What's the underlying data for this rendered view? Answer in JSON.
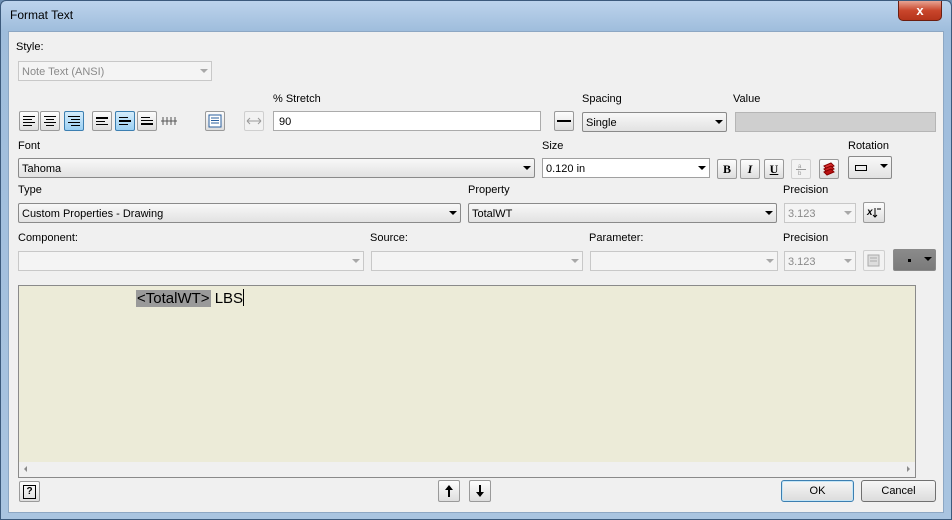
{
  "window": {
    "title": "Format Text",
    "close_glyph": "x"
  },
  "style": {
    "label": "Style:",
    "value": "Note Text (ANSI)"
  },
  "stretch": {
    "label": "% Stretch",
    "value": "90"
  },
  "spacing": {
    "label": "Spacing",
    "value": "Single"
  },
  "value_field": {
    "label": "Value",
    "value": ""
  },
  "font": {
    "label": "Font",
    "value": "Tahoma"
  },
  "size": {
    "label": "Size",
    "value": "0.120 in"
  },
  "format_buttons": {
    "bold": "B",
    "italic": "I",
    "underline": "U"
  },
  "rotation": {
    "label": "Rotation"
  },
  "type": {
    "label": "Type",
    "value": "Custom Properties - Drawing"
  },
  "property": {
    "label": "Property",
    "value": "TotalWT"
  },
  "precision1": {
    "label": "Precision",
    "value": "3.123"
  },
  "component": {
    "label": "Component:",
    "value": ""
  },
  "source": {
    "label": "Source:",
    "value": ""
  },
  "parameter": {
    "label": "Parameter:",
    "value": ""
  },
  "precision2": {
    "label": "Precision",
    "value": "3.123"
  },
  "editor": {
    "field_token": "<TotalWT>",
    "text_after": " LBS"
  },
  "buttons": {
    "ok": "OK",
    "cancel": "Cancel",
    "help": "?"
  },
  "colors": {
    "editor_bg": "#ecebd8",
    "active_button": "#9bd0f3",
    "close_button": "#c9462c"
  }
}
